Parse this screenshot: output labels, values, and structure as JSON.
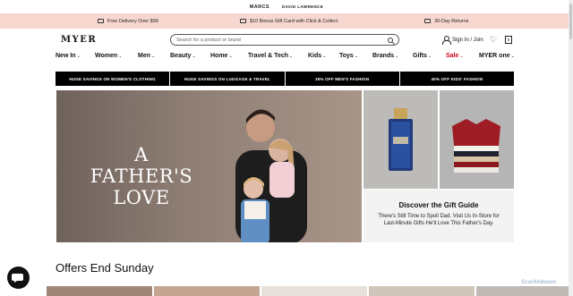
{
  "topbar": {
    "brand1": "MARCS",
    "brand2": "DAVID LAWRENCE"
  },
  "promo": {
    "item1": "Free Delivery Over $99",
    "item2": "$10 Bonus Gift Card with Click & Collect",
    "item3": "30-Day Returns"
  },
  "header": {
    "logo": "MYER",
    "search_placeholder": "Search for a product or brand",
    "signin": "Sign In / Join",
    "bag_count": "0"
  },
  "nav": {
    "items": [
      "New In",
      "Women",
      "Men",
      "Beauty",
      "Home",
      "Travel & Tech",
      "Kids",
      "Toys",
      "Brands",
      "Gifts",
      "Sale",
      "MYER one"
    ],
    "sale_color": "#d0021b"
  },
  "banners": [
    "HUGE SAVINGS ON WOMEN'S CLOTHING",
    "HUGE SAVINGS ON LUGGAGE & TRAVEL",
    "25% OFF MEN'S FASHION",
    "40% OFF KIDS' FASHION"
  ],
  "hero": {
    "title": "A FATHER'S LOVE"
  },
  "gift_guide": {
    "title": "Discover the Gift Guide",
    "description": "There's Still Time to Spoil Dad. Visit Us In-Store for Last-Minute Gifts He'll Love This Father's Day."
  },
  "offers": {
    "title": "Offers End Sunday"
  },
  "watermark": "ScanMalware"
}
